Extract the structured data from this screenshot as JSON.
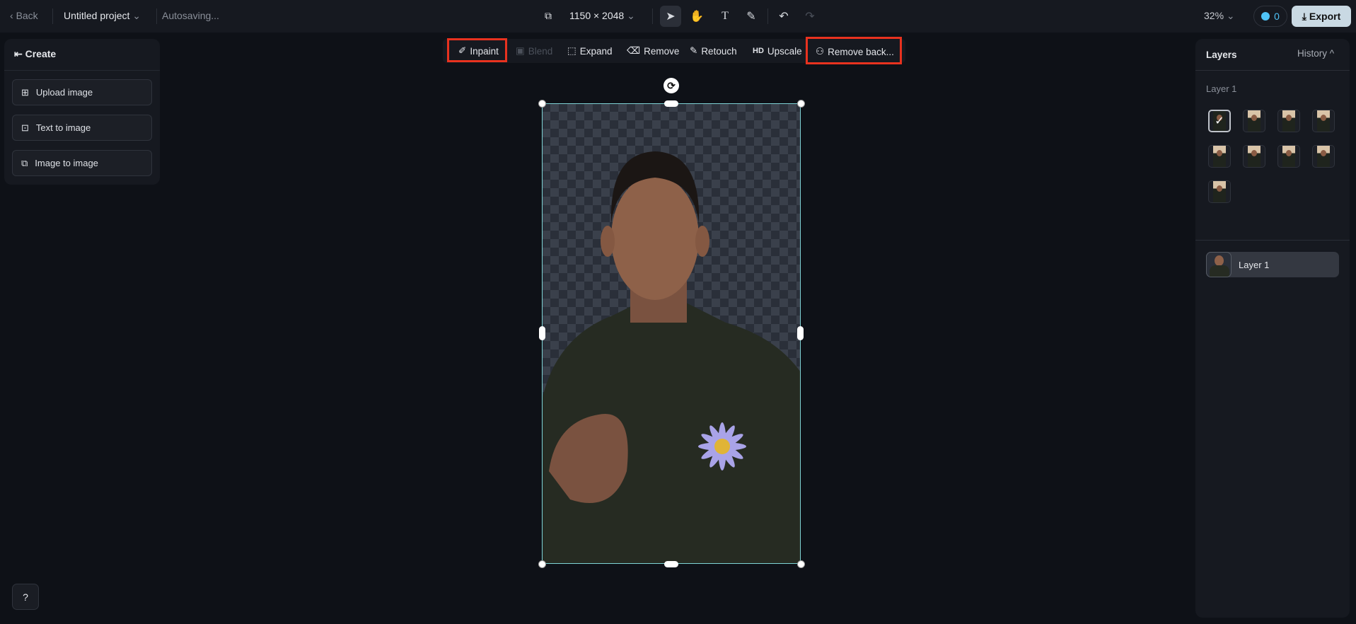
{
  "topbar": {
    "back": "Back",
    "project": "Untitled project",
    "status": "Autosaving...",
    "size": "1150 × 2048",
    "zoom": "32%",
    "credits": "0",
    "export": "Export"
  },
  "left": {
    "header": "Create",
    "buttons": [
      "Upload image",
      "Text to image",
      "Image to image"
    ],
    "help": "?"
  },
  "toolbar": {
    "items": [
      "Inpaint",
      "Blend",
      "Expand",
      "Remove",
      "Retouch",
      "Upscale",
      "Remove back..."
    ],
    "hd": "HD"
  },
  "right": {
    "title": "Layers",
    "history": "History",
    "group_label": "Layer 1",
    "history_count": 9,
    "selected_index": 0,
    "layer_name": "Layer 1"
  },
  "highlight_color": "#e8321f"
}
